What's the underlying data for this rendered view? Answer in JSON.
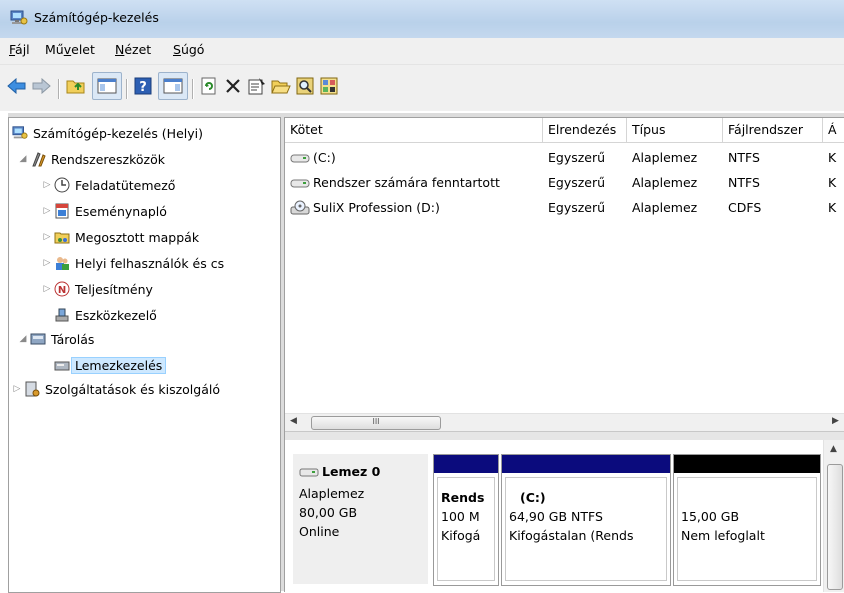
{
  "window": {
    "title": "Számítógép-kezelés"
  },
  "menu": [
    {
      "pre": "",
      "u": "F",
      "post": "ájl"
    },
    {
      "pre": "Mű",
      "u": "v",
      "post": "elet"
    },
    {
      "pre": "",
      "u": "N",
      "post": "ézet"
    },
    {
      "pre": "",
      "u": "S",
      "post": "úgó"
    }
  ],
  "toolbar_icons": [
    "back-arrow-icon",
    "forward-arrow-icon",
    "up-folder-icon",
    "show-hide-tree-icon",
    "help-icon",
    "show-hide-action-pane-icon",
    "refresh-icon",
    "delete-icon",
    "properties-icon",
    "open-folder-icon",
    "search-icon",
    "settings-icon"
  ],
  "tree": [
    {
      "label": "Számítógép-kezelés (Helyi)",
      "icon": "computer-management-icon"
    },
    {
      "label": "Rendszereszközök",
      "icon": "tools-icon"
    },
    {
      "label": "Feladatütemező",
      "icon": "clock-icon"
    },
    {
      "label": "Eseménynapló",
      "icon": "event-log-icon"
    },
    {
      "label": "Megosztott mappák",
      "icon": "shared-folder-icon"
    },
    {
      "label": "Helyi felhasználók és cs",
      "icon": "users-icon"
    },
    {
      "label": "Teljesítmény",
      "icon": "performance-icon"
    },
    {
      "label": "Eszközkezelő",
      "icon": "device-manager-icon"
    },
    {
      "label": "Tárolás",
      "icon": "storage-icon"
    },
    {
      "label": "Lemezkezelés",
      "icon": "disk-management-icon"
    },
    {
      "label": "Szolgáltatások és kiszolgáló",
      "icon": "services-icon"
    }
  ],
  "volumes": {
    "columns": [
      "Kötet",
      "Elrendezés",
      "Típus",
      "Fájlrendszer",
      "Á"
    ],
    "rows": [
      {
        "name": "(C:)",
        "layout": "Egyszerű",
        "type": "Alaplemez",
        "fs": "NTFS",
        "status": "K",
        "icon": "drive-icon"
      },
      {
        "name": "Rendszer számára fenntartott",
        "layout": "Egyszerű",
        "type": "Alaplemez",
        "fs": "NTFS",
        "status": "K",
        "icon": "drive-icon"
      },
      {
        "name": "SuliX Profession (D:)",
        "layout": "Egyszerű",
        "type": "Alaplemez",
        "fs": "CDFS",
        "status": "K",
        "icon": "cd-drive-icon"
      }
    ],
    "scroll_grip": "III"
  },
  "disk": {
    "name": "Lemez 0",
    "type": "Alaplemez",
    "size": "80,00 GB",
    "status": "Online",
    "partitions": [
      {
        "l1": "Rends",
        "l2": "100 M",
        "l3": "Kifogá",
        "color": "#0b0b7d"
      },
      {
        "l1": "(C:)",
        "l2": "64,90 GB NTFS",
        "l3": "Kifogástalan (Rends",
        "color": "#0b0b7d"
      },
      {
        "l1": "",
        "l2": "15,00 GB",
        "l3": "Nem lefoglalt",
        "color": "#000000"
      }
    ]
  }
}
